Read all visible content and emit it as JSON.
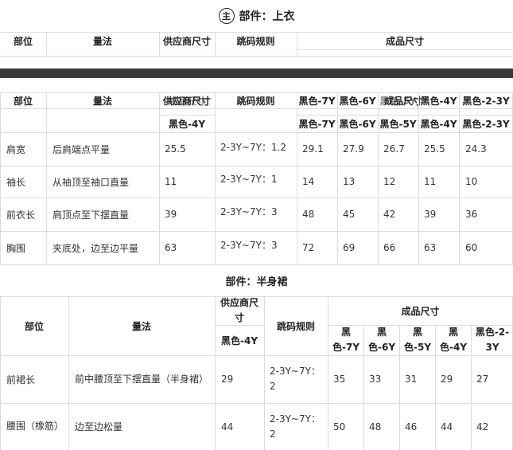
{
  "top": {
    "icon": "主",
    "title": "部件：上衣",
    "headers": [
      "部位",
      "量法",
      "供应商尺寸",
      "跳码规则",
      "成品尺寸"
    ]
  },
  "top_table": {
    "headers": [
      "部位",
      "量法",
      "供应商尺寸",
      "跳码规则"
    ],
    "header_overlay": "成品尺寸",
    "header_sizes": [
      "黑色-7Y",
      "黑色-6Y",
      "黑色-5Y",
      "黑色-4Y",
      "黑色-2-3Y"
    ],
    "supplier_size": "黑色-4Y",
    "sizes": [
      "黑色-7Y",
      "黑色-6Y",
      "黑色-5Y",
      "黑色-4Y",
      "黑色-2-3Y"
    ],
    "rows": [
      {
        "part": "肩宽",
        "method": "后肩端点平量",
        "supplier": "25.5",
        "rule": "2-3Y~7Y：1.2",
        "values": [
          "29.1",
          "27.9",
          "26.7",
          "25.5",
          "24.3"
        ]
      },
      {
        "part": "袖长",
        "method": "从袖顶至袖口直量",
        "supplier": "11",
        "rule": "2-3Y~7Y：1",
        "values": [
          "14",
          "13",
          "12",
          "11",
          "10"
        ]
      },
      {
        "part": "前衣长",
        "method": "肩顶点至下摆直量",
        "supplier": "39",
        "rule": "2-3Y~7Y：3",
        "values": [
          "48",
          "45",
          "42",
          "39",
          "36"
        ]
      },
      {
        "part": "胸围",
        "method": "夹底处，边至边平量",
        "supplier": "63",
        "rule": "2-3Y~7Y：3",
        "values": [
          "72",
          "69",
          "66",
          "63",
          "60"
        ]
      }
    ]
  },
  "skirt": {
    "title": "部件：半身裙",
    "headers": {
      "part": "部位",
      "method": "量法",
      "supplier": "供应商尺寸",
      "rule": "跳码规则",
      "finished": "成品尺寸"
    },
    "supplier_size": "黑色-4Y",
    "sizes": [
      "黑色-7Y",
      "黑色-6Y",
      "黑色-5Y",
      "黑色-4Y",
      "黑色-2-3Y"
    ],
    "rows": [
      {
        "part": "前裙长",
        "method": "前中腰顶至下摆直量（半身裙）",
        "supplier": "29",
        "rule": "2-3Y~7Y：2",
        "values": [
          "35",
          "33",
          "31",
          "29",
          "27"
        ]
      },
      {
        "part": "腰围（橡筋）",
        "method": "边至边松量",
        "supplier": "44",
        "rule": "2-3Y~7Y：2",
        "values": [
          "50",
          "48",
          "46",
          "44",
          "42"
        ]
      }
    ]
  }
}
